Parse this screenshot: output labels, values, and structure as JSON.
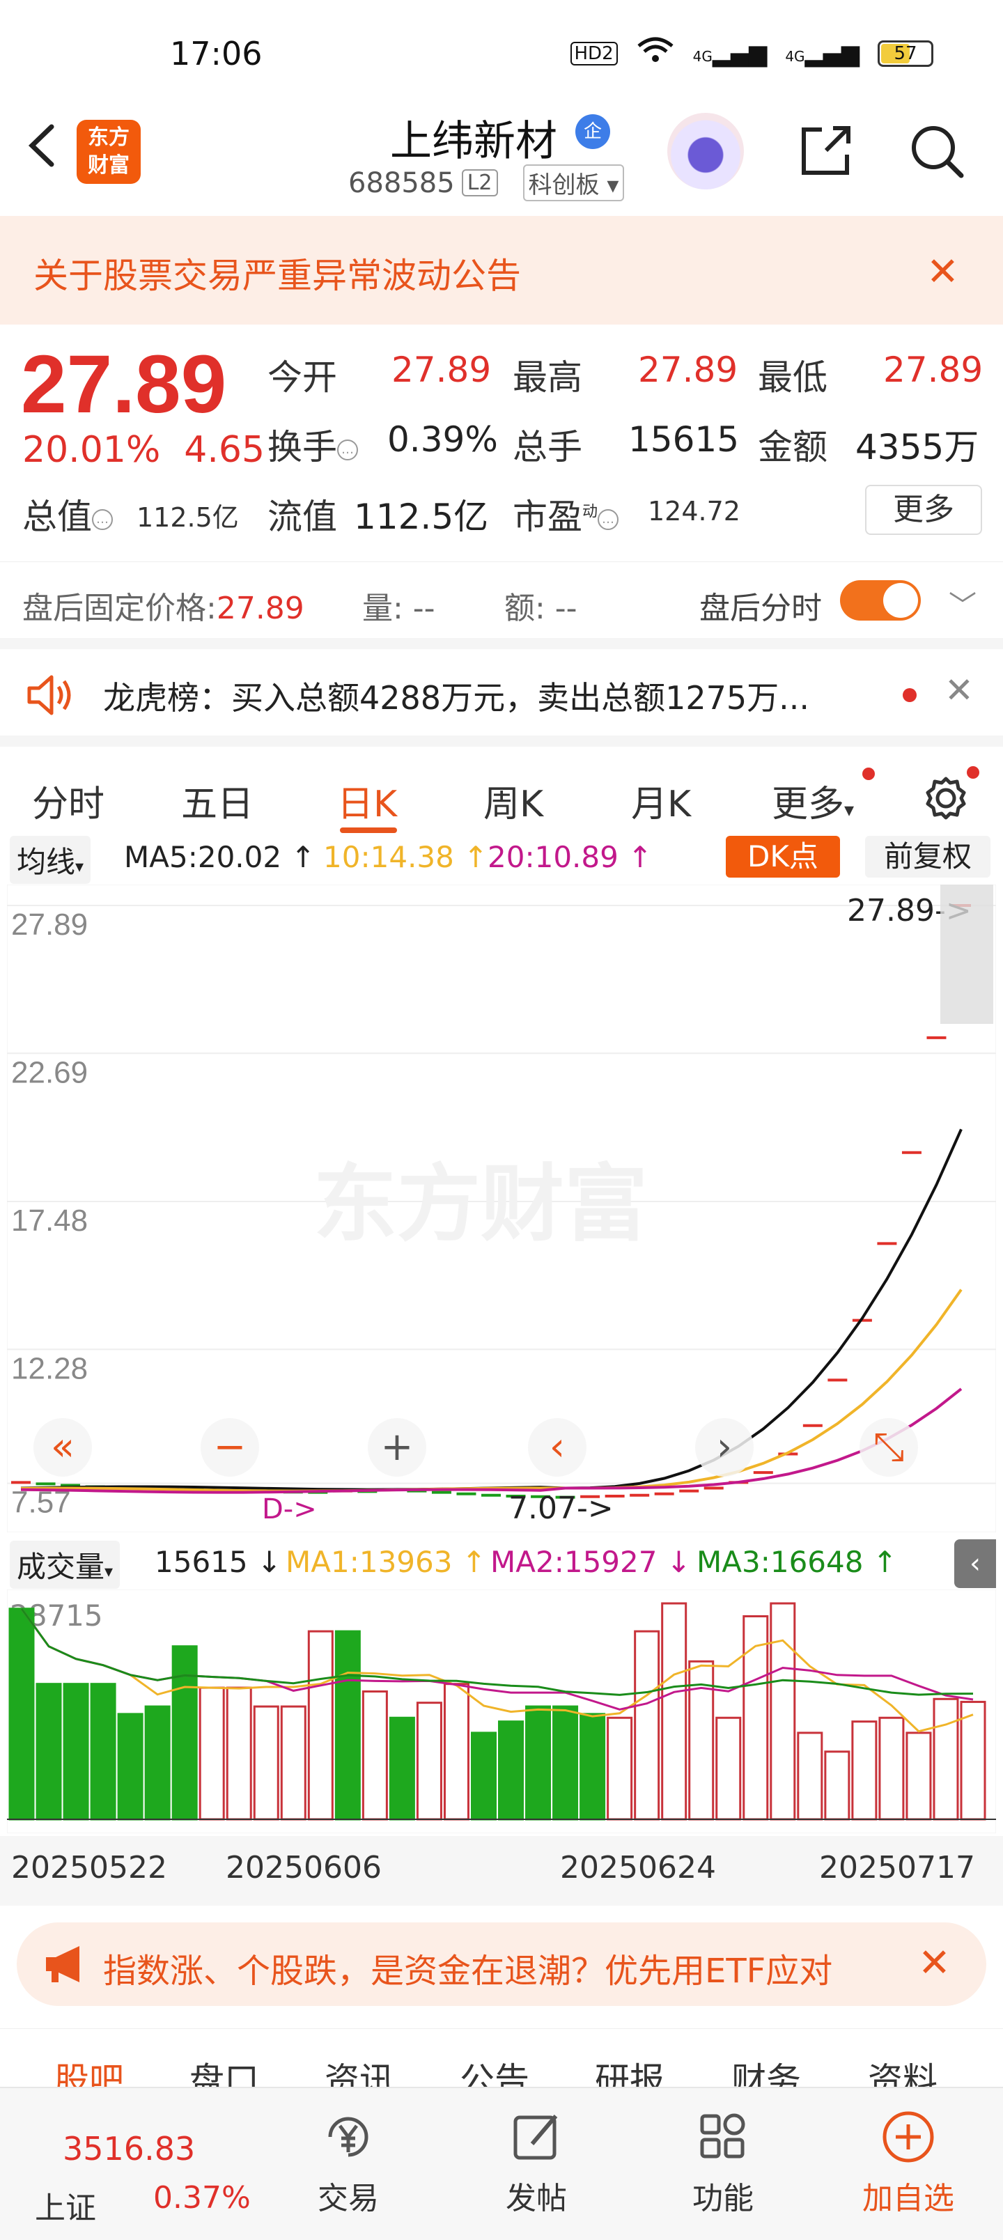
{
  "status_bar": {
    "time": "17:06",
    "battery": "57",
    "network": [
      "HD2",
      "4G",
      "4G"
    ]
  },
  "header": {
    "stock_name": "上纬新材",
    "corp_badge": "企",
    "code": "688585",
    "level": "L2",
    "board": "科创板"
  },
  "notice": {
    "text": "关于股票交易严重异常波动公告"
  },
  "quote": {
    "price": "27.89",
    "change_pct": "20.01%",
    "change_amt": "4.65",
    "open_label": "今开",
    "open": "27.89",
    "high_label": "最高",
    "high": "27.89",
    "low_label": "最低",
    "low": "27.89",
    "turnover_label": "换手",
    "turnover": "0.39%",
    "volume_label": "总手",
    "volume": "15615",
    "amount_label": "金额",
    "amount": "4355万",
    "mktcap_label": "总值",
    "mktcap": "112.5亿",
    "float_label": "流值",
    "float": "112.5亿",
    "pe_label": "市盈",
    "pe_sup": "动",
    "pe": "124.72",
    "more_label": "更多"
  },
  "after_hours": {
    "fixed_price_label": "盘后固定价格:",
    "fixed_price": "27.89",
    "vol_label": "量: --",
    "amt_label": "额: --",
    "timeshare_label": "盘后分时"
  },
  "dragon_tiger": {
    "text": "龙虎榜：买入总额4288万元，卖出总额1275万..."
  },
  "tabs": [
    {
      "label": "分时"
    },
    {
      "label": "五日"
    },
    {
      "label": "日K"
    },
    {
      "label": "周K"
    },
    {
      "label": "月K"
    },
    {
      "label": "更多"
    }
  ],
  "ma_bar": {
    "selector": "均线",
    "ma5": "MA5:20.02",
    "ma10": "10:14.38",
    "ma20": "20:10.89",
    "dk_label": "DK点",
    "adjust_label": "前复权"
  },
  "kchart": {
    "y_labels": [
      "27.89",
      "22.69",
      "17.48",
      "12.28",
      "7.57"
    ],
    "last_price_tag": "27.89->",
    "low_tag": "7.07->",
    "d_tag": "D->",
    "watermark": "东方财富"
  },
  "vol_bar": {
    "selector": "成交量",
    "volume": "15615",
    "ma1": "MA1:13963",
    "ma2": "MA2:15927",
    "ma3": "MA3:16648",
    "max_label": "28715"
  },
  "dates": [
    "20250522",
    "20250606",
    "20250624",
    "20250717"
  ],
  "chart_data": [
    {
      "type": "candlestick",
      "title": "",
      "ylim": [
        7.07,
        27.89
      ],
      "y_ticks": [
        27.89,
        22.69,
        17.48,
        12.28,
        7.57
      ],
      "closes": [
        7.6,
        7.55,
        7.5,
        7.45,
        7.4,
        7.45,
        7.4,
        7.35,
        7.3,
        7.28,
        7.3,
        7.26,
        7.25,
        7.3,
        7.28,
        7.35,
        7.3,
        7.25,
        7.2,
        7.15,
        7.12,
        7.1,
        7.08,
        7.1,
        7.12,
        7.15,
        7.2,
        7.3,
        7.4,
        7.6,
        7.95,
        8.6,
        9.6,
        11.2,
        13.3,
        16.0,
        19.2,
        23.24,
        27.89
      ],
      "series": [
        {
          "name": "MA5",
          "color": "#111111",
          "last": 20.02
        },
        {
          "name": "MA10",
          "color": "#f0b429",
          "last": 14.38
        },
        {
          "name": "MA20",
          "color": "#c2188b",
          "last": 10.89
        }
      ]
    },
    {
      "type": "bar",
      "title": "成交量",
      "ylim": [
        0,
        28715
      ],
      "values": [
        28000,
        18000,
        18000,
        18000,
        14000,
        15000,
        23000,
        17500,
        17500,
        15000,
        15000,
        25000,
        25000,
        17000,
        13500,
        15500,
        18000,
        11500,
        13000,
        15000,
        15000,
        14000,
        13500,
        25000,
        28715,
        21000,
        13500,
        27000,
        28715,
        11500,
        9000,
        13000,
        13500,
        11500,
        16000,
        15615
      ],
      "up": [
        false,
        false,
        false,
        false,
        false,
        false,
        false,
        true,
        true,
        true,
        true,
        true,
        false,
        true,
        false,
        true,
        true,
        false,
        false,
        false,
        false,
        false,
        true,
        true,
        true,
        true,
        true,
        true,
        true,
        true,
        true,
        true,
        true,
        true,
        true,
        true
      ],
      "series": [
        {
          "name": "MA1",
          "color": "#f0b429",
          "last": 13963
        },
        {
          "name": "MA2",
          "color": "#c2188b",
          "last": 15927
        },
        {
          "name": "MA3",
          "color": "#1a8c1a",
          "last": 16648
        }
      ]
    }
  ],
  "banner": {
    "text": "指数涨、个股跌，是资金在退潮？优先用ETF应对"
  },
  "sub_tabs": [
    "股吧",
    "盘口",
    "资讯",
    "公告",
    "研报",
    "财务",
    "资料"
  ],
  "bottom_nav": {
    "index_value": "3516.83",
    "index_name": "上证",
    "index_change": "0.37%",
    "items": [
      {
        "label": "交易"
      },
      {
        "label": "发帖"
      },
      {
        "label": "功能"
      },
      {
        "label": "加自选"
      }
    ]
  }
}
